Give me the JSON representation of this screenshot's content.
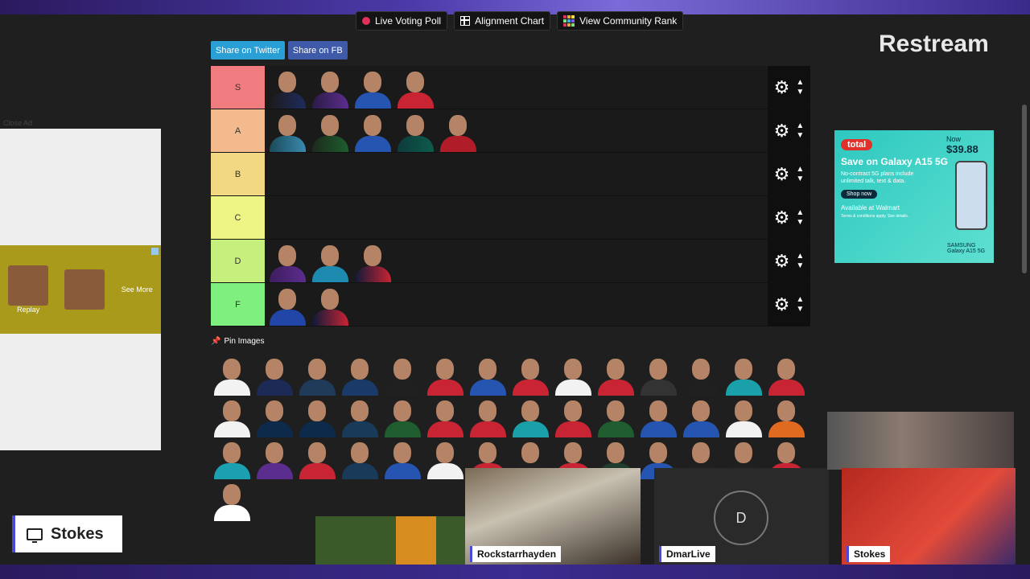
{
  "top_buttons": [
    {
      "label": "Live Voting Poll",
      "icon": "red-dot-icon"
    },
    {
      "label": "Alignment Chart",
      "icon": "grid-icon"
    },
    {
      "label": "View Community Rank",
      "icon": "multicolor-grid-icon"
    }
  ],
  "share": {
    "twitter": "Share on Twitter",
    "facebook": "Share on FB"
  },
  "brand": "Restream",
  "tiers": [
    {
      "label": "S",
      "color": "#f07c7f",
      "players": [
        "#1b1b1b:#1f2b5e",
        "#2b1b45:#5b2d8e",
        "#2555b0:#2555b0",
        "#c82434:#c82434"
      ]
    },
    {
      "label": "A",
      "color": "#f3ba8d",
      "players": [
        "#1a4a5a:#3a8ab0",
        "#1b2b1b:#1f5d2f",
        "#2555b0:#2555b0",
        "#0d3b3b:#0d5b4b",
        "#b01c28:#b01c28"
      ]
    },
    {
      "label": "B",
      "color": "#f2d882",
      "players": []
    },
    {
      "label": "C",
      "color": "#eff584",
      "players": []
    },
    {
      "label": "D",
      "color": "#c6ef7d",
      "players": [
        "#3d1d5e:#5b2d8e",
        "#1e8ab0:#1e8ab0",
        "#101a38:#c82434"
      ]
    },
    {
      "label": "F",
      "color": "#7ff07f",
      "players": [
        "#2245a8:#2245a8",
        "#0e1a3a:#c82434"
      ]
    }
  ],
  "pin_label": "Pin Images",
  "pool": [
    "#f2f2f2",
    "#1c2a55",
    "#203a5a",
    "#1a3a6a",
    "#202020",
    "#c82434",
    "#2555b0",
    "#c82434",
    "#f2f2f2",
    "#c82434",
    "#333333",
    "#202020",
    "#1aa0a8",
    "#c82434",
    "#f2f2f2",
    "#0d2a4a",
    "#0d2a4a",
    "#1a3a5a",
    "#1f5d2f",
    "#c82434",
    "#c82434",
    "#1aa0a8",
    "#c82434",
    "#1f5d2f",
    "#2555b0",
    "#2555b0",
    "#f2f2f2",
    "#e06a20",
    "#1aa0b0",
    "#5b2d8e",
    "#c82434",
    "#1a3a5a",
    "#2555b0",
    "#f2f2f2",
    "#c82434",
    "#202020",
    "#c82434",
    "#1f3d2f",
    "#2555b0",
    "#202020",
    "#202020",
    "#c82434",
    "#ffffff"
  ],
  "left_ad": {
    "close": "Close Ad",
    "replay": "Replay",
    "see_more": "See More"
  },
  "total_ad": {
    "badge": "total",
    "price_label": "Now",
    "price": "$39.88",
    "headline": "Save on Galaxy A15 5G",
    "sub": "No-contract 5G plans include unlimited talk, text & data.",
    "shop": "Shop now",
    "available": "Available at Walmart",
    "terms": "Terms & conditions apply. See details.",
    "model": "SAMSUNG Galaxy A15 5G"
  },
  "scene_label": "Stokes",
  "participants": [
    "Rockstarrhayden",
    "DmarLive",
    "Stokes"
  ],
  "avatar_initial": "D"
}
